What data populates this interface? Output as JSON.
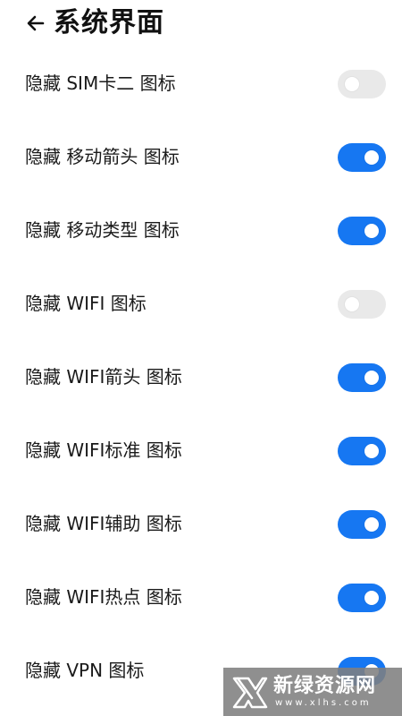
{
  "header": {
    "title": "系统界面",
    "back_icon": "arrow-left-icon"
  },
  "settings": [
    {
      "label": "隐藏 SIM卡二 图标",
      "enabled": false
    },
    {
      "label": "隐藏 移动箭头 图标",
      "enabled": true
    },
    {
      "label": "隐藏 移动类型 图标",
      "enabled": true
    },
    {
      "label": "隐藏 WIFI 图标",
      "enabled": false
    },
    {
      "label": "隐藏 WIFI箭头 图标",
      "enabled": true
    },
    {
      "label": "隐藏 WIFI标准 图标",
      "enabled": true
    },
    {
      "label": "隐藏 WIFI辅助 图标",
      "enabled": true
    },
    {
      "label": "隐藏 WIFI热点 图标",
      "enabled": true
    },
    {
      "label": "隐藏 VPN 图标",
      "enabled": true
    }
  ],
  "watermark": {
    "name": "新绿资源网",
    "url": "www.xlhs.com"
  },
  "colors": {
    "toggle_on": "#1677f2",
    "toggle_off": "#e9e9e9",
    "background": "#ffffff"
  }
}
